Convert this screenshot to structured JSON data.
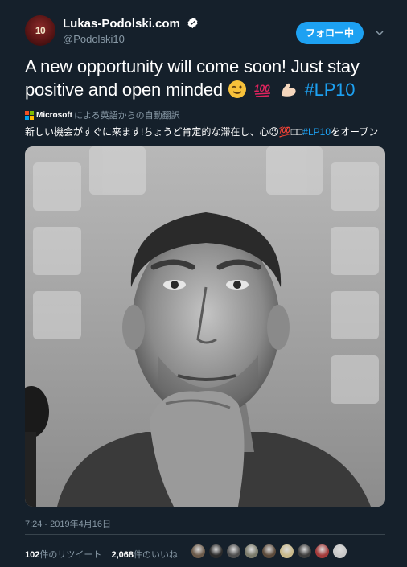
{
  "author": {
    "display_name": "Lukas-Podolski.com",
    "handle": "@Podolski10",
    "avatar_text": "10",
    "verified": true
  },
  "follow_button": {
    "label": "フォロー中"
  },
  "tweet": {
    "text_line1": "A new opportunity will come soon! Just stay",
    "text_line2_prefix": "positive and open minded",
    "emojis": [
      "winking-face",
      "hundred-points",
      "flexed-biceps"
    ],
    "hashtag": "#LP10"
  },
  "translation": {
    "provider": "Microsoft",
    "attribution": "による英語からの自動翻訳",
    "text_prefix": "新しい機会がすぐに来ます!ちょうど肯定的な滞在し、心",
    "text_emoji": "😉💯",
    "text_boxes": "□□",
    "hashtag": "#LP10",
    "text_suffix": "をオープン"
  },
  "photo": {
    "icon": "photo-image"
  },
  "timestamp": "7:24 - 2019年4月16日",
  "stats": {
    "retweets_count": "102",
    "retweets_label": "件のリツイート",
    "likes_count": "2,068",
    "likes_label": "件のいいね"
  },
  "liker_avatars": [
    {
      "color": "#6b5a4a"
    },
    {
      "color": "#2b2b2b"
    },
    {
      "color": "#4d4d4d"
    },
    {
      "color": "#7a7a6a"
    },
    {
      "color": "#5b4a3b"
    },
    {
      "color": "#c9b98a"
    },
    {
      "color": "#3c3c3c"
    },
    {
      "color": "#a33a3a"
    },
    {
      "color": "#c8c8c8"
    }
  ],
  "colors": {
    "background": "#15202b",
    "accent": "#1da1f2",
    "secondary_text": "#8899a6",
    "divider": "#38444d"
  }
}
